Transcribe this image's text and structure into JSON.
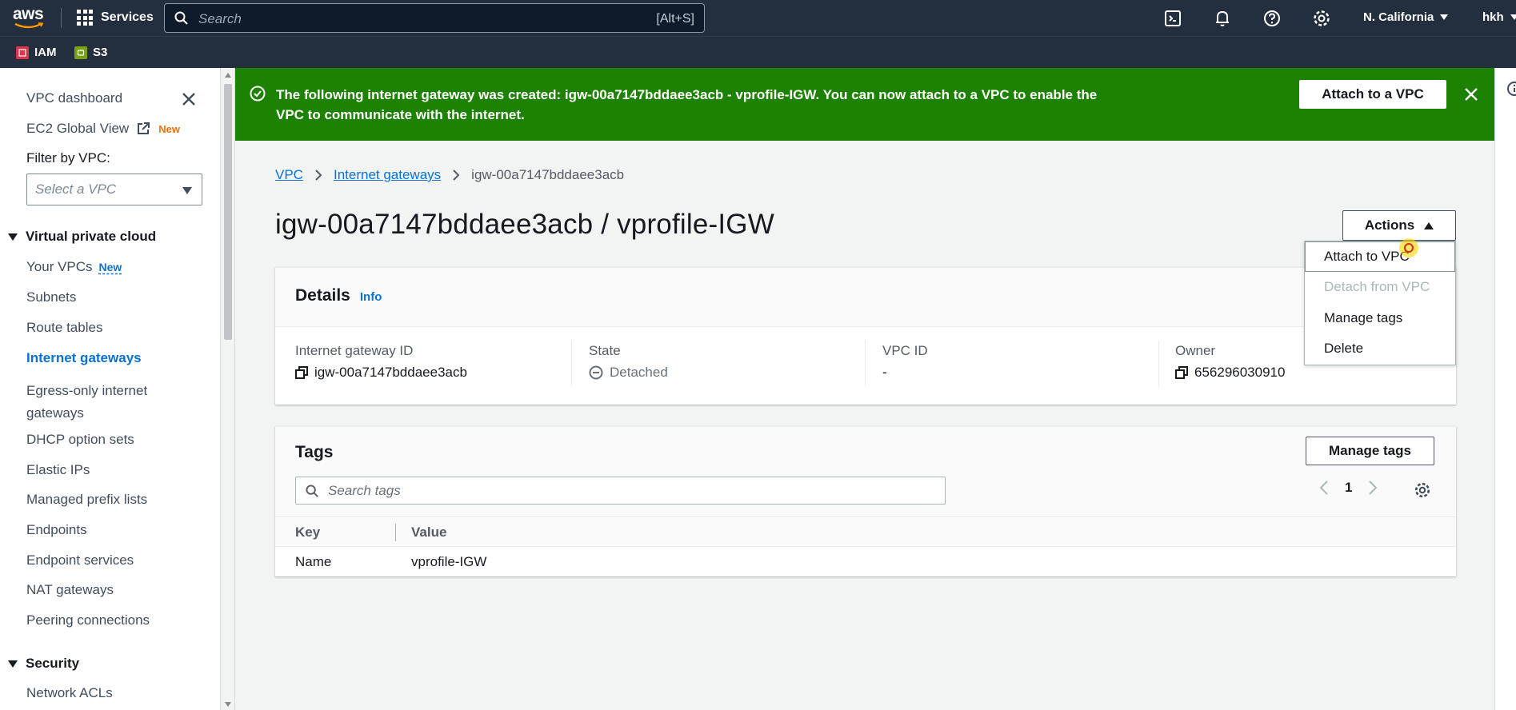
{
  "topnav": {
    "logo": "aws",
    "services_label": "Services",
    "search_placeholder": "Search",
    "search_shortcut": "[Alt+S]",
    "region": "N. California",
    "user": "hkh",
    "icons": [
      "cloudshell-icon",
      "bell-icon",
      "help-icon",
      "settings-icon"
    ]
  },
  "favorites": [
    {
      "label": "IAM",
      "color": "#dd344c"
    },
    {
      "label": "S3",
      "color": "#7aa116"
    }
  ],
  "sidebar": {
    "top_links": [
      {
        "label": "VPC dashboard"
      },
      {
        "label": "EC2 Global View",
        "badge": "New"
      }
    ],
    "filter_label": "Filter by VPC:",
    "filter_placeholder": "Select a VPC",
    "sections": [
      {
        "title": "Virtual private cloud",
        "items": [
          {
            "label": "Your VPCs",
            "badge": "New"
          },
          {
            "label": "Subnets"
          },
          {
            "label": "Route tables"
          },
          {
            "label": "Internet gateways",
            "active": true
          },
          {
            "label": "Egress-only internet",
            "label2": "gateways"
          },
          {
            "label": "DHCP option sets"
          },
          {
            "label": "Elastic IPs"
          },
          {
            "label": "Managed prefix lists"
          },
          {
            "label": "Endpoints"
          },
          {
            "label": "Endpoint services"
          },
          {
            "label": "NAT gateways"
          },
          {
            "label": "Peering connections"
          }
        ]
      },
      {
        "title": "Security",
        "items": [
          {
            "label": "Network ACLs"
          }
        ]
      }
    ]
  },
  "flash": {
    "message": "The following internet gateway was created: igw-00a7147bddaee3acb - vprofile-IGW. You can now attach to a VPC to enable the VPC to communicate with the internet.",
    "action_label": "Attach to a VPC",
    "color": "#1d8102"
  },
  "breadcrumb": [
    {
      "label": "VPC",
      "link": true
    },
    {
      "label": "Internet gateways",
      "link": true
    },
    {
      "label": "igw-00a7147bddaee3acb",
      "link": false
    }
  ],
  "page_title": "igw-00a7147bddaee3acb / vprofile-IGW",
  "actions": {
    "label": "Actions",
    "menu": [
      {
        "label": "Attach to VPC",
        "disabled": false,
        "hovered": true
      },
      {
        "label": "Detach from VPC",
        "disabled": true
      },
      {
        "label": "Manage tags",
        "disabled": false
      },
      {
        "label": "Delete",
        "disabled": false
      }
    ]
  },
  "details": {
    "title": "Details",
    "info_label": "Info",
    "fields": [
      {
        "label": "Internet gateway ID",
        "value": "igw-00a7147bddaee3acb"
      },
      {
        "label": "State",
        "value": "Detached"
      },
      {
        "label": "VPC ID",
        "value": "-"
      },
      {
        "label": "Owner",
        "value": "656296030910"
      }
    ]
  },
  "tags": {
    "title": "Tags",
    "manage_label": "Manage tags",
    "search_placeholder": "Search tags",
    "page": "1",
    "columns": [
      "Key",
      "Value"
    ],
    "rows": [
      {
        "key": "Name",
        "value": "vprofile-IGW"
      }
    ]
  }
}
